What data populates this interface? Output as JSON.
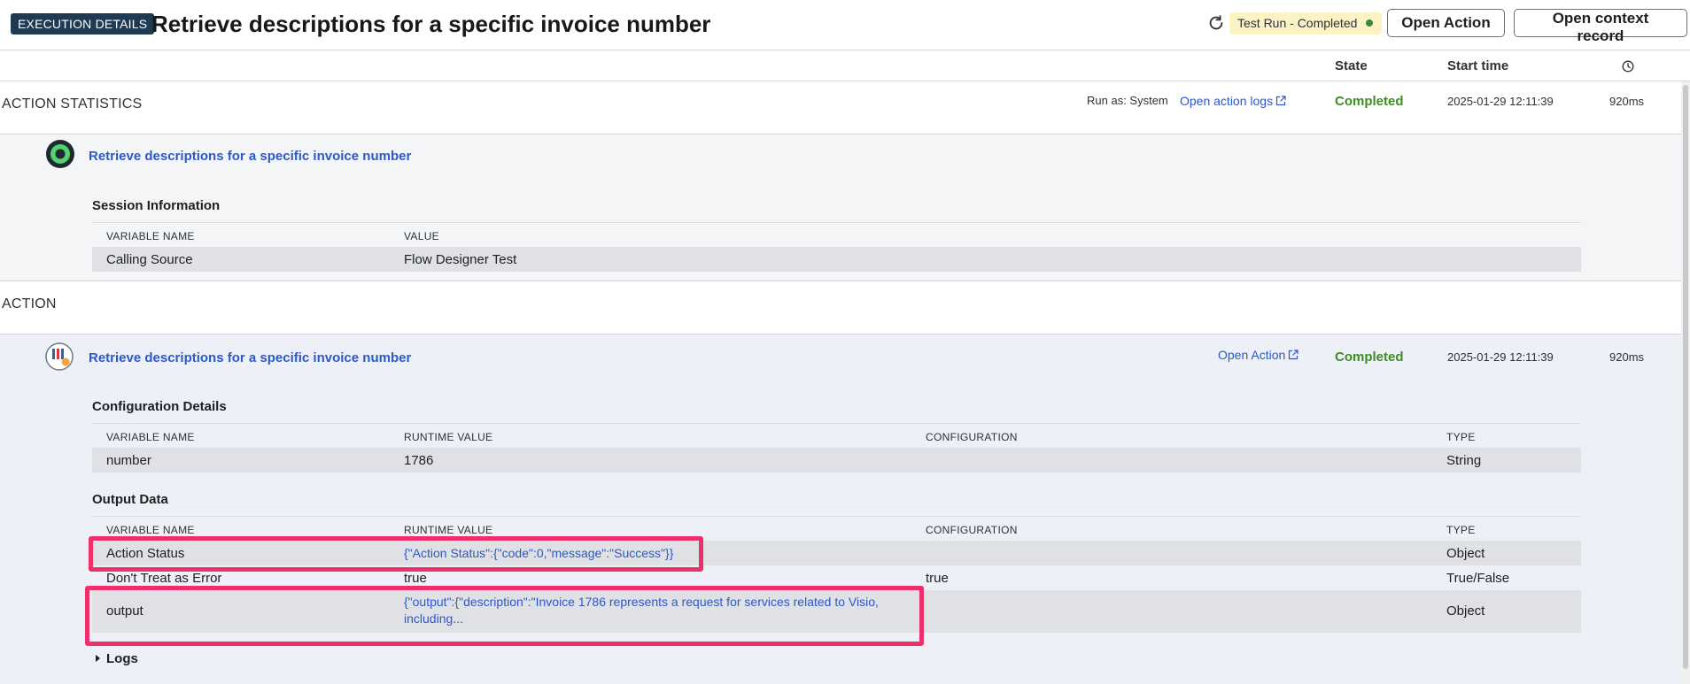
{
  "header": {
    "tag": "EXECUTION DETAILS",
    "title": "Retrieve descriptions for a specific invoice number",
    "status_pill": "Test Run - Completed",
    "open_action_button": "Open Action",
    "open_context_button": "Open context record"
  },
  "columns": {
    "state": "State",
    "start_time": "Start time",
    "duration_icon": "clock-icon"
  },
  "action_statistics": {
    "label": "ACTION STATISTICS",
    "run_as": "Run as: System",
    "open_logs_link": "Open action logs",
    "state": "Completed",
    "start_time": "2025-01-29 12:11:39",
    "duration": "920ms",
    "node_title": "Retrieve descriptions for a specific invoice number",
    "session_heading": "Session Information",
    "session_table": {
      "headers": [
        "VARIABLE NAME",
        "VALUE"
      ],
      "rows": [
        [
          "Calling Source",
          "Flow Designer Test"
        ]
      ]
    }
  },
  "action": {
    "label": "ACTION",
    "node_title": "Retrieve descriptions for a specific invoice number",
    "open_action_link": "Open Action",
    "state": "Completed",
    "start_time": "2025-01-29 12:11:39",
    "duration": "920ms",
    "config_heading": "Configuration Details",
    "config_table": {
      "headers": [
        "VARIABLE NAME",
        "RUNTIME VALUE",
        "CONFIGURATION",
        "TYPE"
      ],
      "rows": [
        [
          "number",
          "1786",
          "",
          "String"
        ]
      ]
    },
    "output_heading": "Output Data",
    "output_table": {
      "headers": [
        "VARIABLE NAME",
        "RUNTIME VALUE",
        "CONFIGURATION",
        "TYPE"
      ],
      "rows": [
        [
          "Action Status",
          "{\"Action Status\":{\"code\":0,\"message\":\"Success\"}}",
          "",
          "Object"
        ],
        [
          "Don't Treat as Error",
          "true",
          "true",
          "True/False"
        ],
        [
          "output",
          "{\"output\":{\"description\":\"Invoice 1786 represents a request for services related to Visio,",
          "",
          "Object"
        ]
      ],
      "output_value_line2": "including..."
    },
    "logs_toggle": "Logs"
  },
  "colors": {
    "accent_link": "#2d58c8",
    "state_ok": "#3f8b25",
    "highlight": "#ee2f6b",
    "tag_bg": "#1f3a52"
  }
}
